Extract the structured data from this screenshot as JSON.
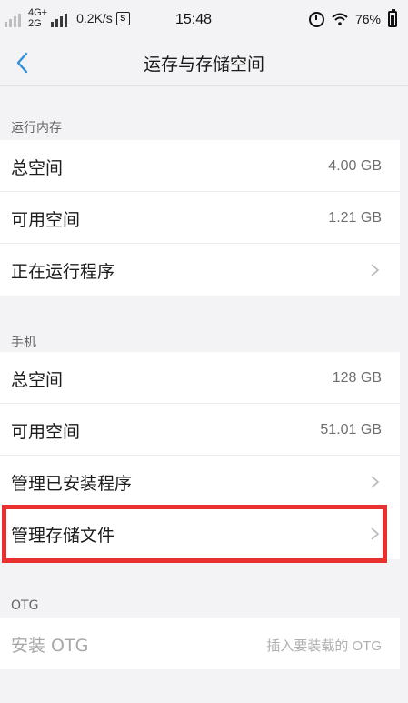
{
  "status_bar": {
    "network_type_top": "4G+",
    "network_type_bottom": "2G",
    "speed": "0.2K/s",
    "s_badge": "S",
    "time": "15:48",
    "battery": "76%"
  },
  "header": {
    "title": "运存与存储空间"
  },
  "ram": {
    "section_title": "运行内存",
    "rows": [
      {
        "label": "总空间",
        "value": "4.00 GB"
      },
      {
        "label": "可用空间",
        "value": "1.21 GB"
      },
      {
        "label": "正在运行程序"
      }
    ]
  },
  "phone": {
    "section_title": "手机",
    "rows": [
      {
        "label": "总空间",
        "value": "128 GB"
      },
      {
        "label": "可用空间",
        "value": "51.01 GB"
      },
      {
        "label": "管理已安装程序"
      },
      {
        "label": "管理存储文件"
      }
    ]
  },
  "otg": {
    "section_title": "OTG",
    "install_label": "安装 OTG",
    "install_hint": "插入要装载的 OTG"
  },
  "icons": {
    "back": "chevron-left-icon",
    "row_arrow": "chevron-right-icon",
    "alarm": "alarm-clock-icon",
    "wifi": "wifi-icon",
    "battery": "battery-icon"
  },
  "colors": {
    "accent": "#2f8fd8",
    "highlight": "#e8302f"
  }
}
